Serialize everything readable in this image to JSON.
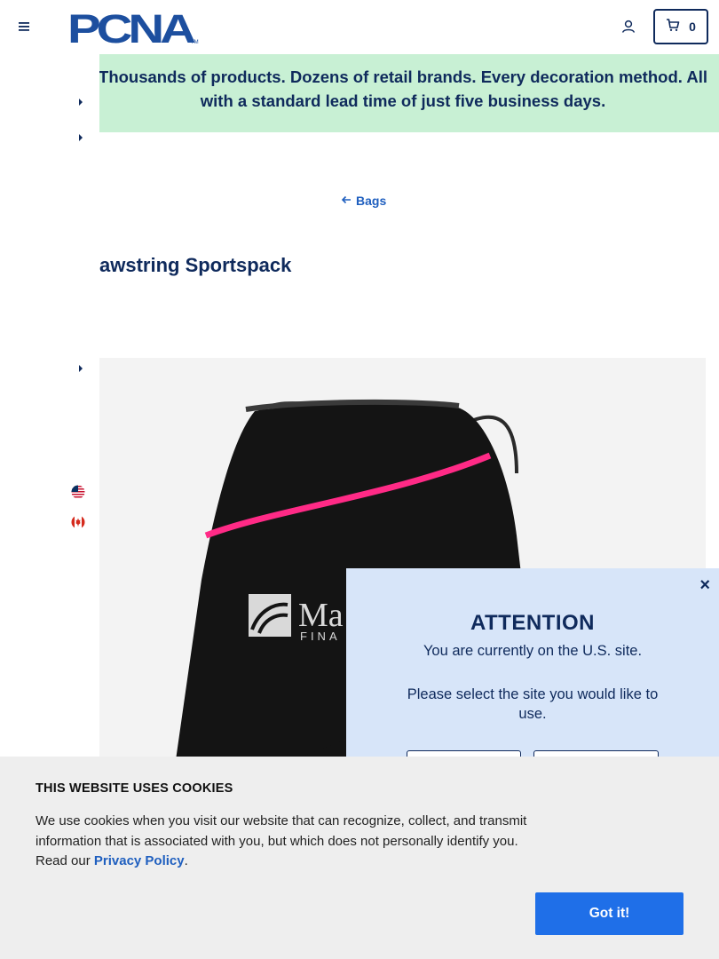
{
  "header": {
    "logo_text": "PCNA",
    "cart_count": "0"
  },
  "banner": {
    "text": "Thousands of products. Dozens of retail brands. Every decoration method. All with a standard lead time of just five business days."
  },
  "breadcrumb": {
    "back_label": "Bags"
  },
  "product": {
    "title": "awstring Sportspack",
    "imprint_text": "Ma",
    "imprint_subtext": "FINA",
    "bag_color": "#141414",
    "accent_color": "#ff2a86"
  },
  "region_modal": {
    "close_label": "×",
    "title": "ATTENTION",
    "message": "You are currently on the U.S. site.",
    "prompt": "Please select the site you would like to use."
  },
  "cookie_banner": {
    "title": "THIS WEBSITE USES COOKIES",
    "text_before": "We use cookies when you visit our website that can recognize, collect, and transmit information that is associated with you, but which does not personally identify you. Read our ",
    "link_label": "Privacy Policy",
    "text_after": ".",
    "accept_label": "Got it!"
  },
  "colors": {
    "navy": "#0f2a5c",
    "link_blue": "#1f5fbf",
    "banner_green": "#c8f0d4",
    "modal_blue": "#d7e5f9",
    "button_blue": "#1f6fe8"
  },
  "icons": [
    "hamburger-menu-icon",
    "account-icon",
    "cart-icon",
    "chevron-right-icon",
    "arrow-left-icon",
    "us-flag-icon",
    "canada-flag-icon",
    "close-icon"
  ]
}
